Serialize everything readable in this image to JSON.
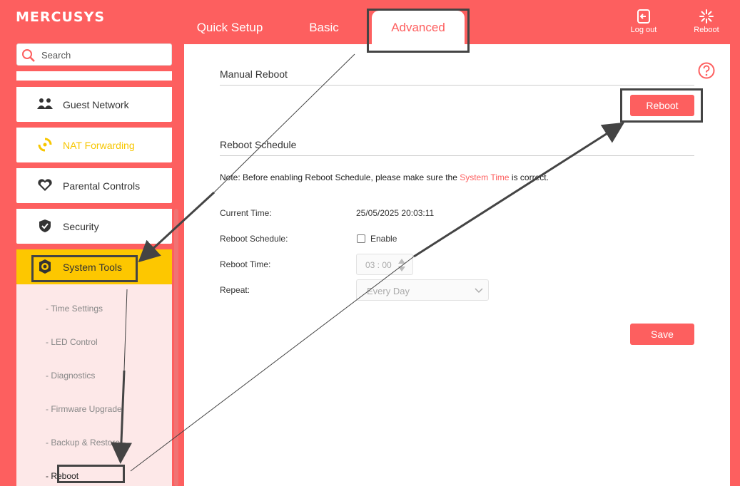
{
  "header": {
    "logo": "MERCUSYS",
    "tabs": [
      {
        "label": "Quick Setup"
      },
      {
        "label": "Basic"
      },
      {
        "label": "Advanced"
      }
    ],
    "logout_label": "Log out",
    "reboot_label": "Reboot"
  },
  "sidebar": {
    "search_placeholder": "Search",
    "items": [
      {
        "label": "Guest Network",
        "icon": "guest-network-icon"
      },
      {
        "label": "NAT Forwarding",
        "icon": "nat-forwarding-icon"
      },
      {
        "label": "Parental Controls",
        "icon": "heart-icon"
      },
      {
        "label": "Security",
        "icon": "shield-icon"
      },
      {
        "label": "System Tools",
        "icon": "gear-icon"
      }
    ],
    "subitems": [
      {
        "label": "- Time Settings"
      },
      {
        "label": "- LED Control"
      },
      {
        "label": "- Diagnostics"
      },
      {
        "label": "- Firmware Upgrade"
      },
      {
        "label": "- Backup & Restore"
      },
      {
        "label": "- Reboot"
      }
    ]
  },
  "main": {
    "manual_reboot_title": "Manual Reboot",
    "reboot_button": "Reboot",
    "schedule_title": "Reboot Schedule",
    "note_prefix": "Note: Before enabling Reboot Schedule, please make sure the ",
    "note_link": "System Time",
    "note_suffix": " is correct.",
    "current_time_label": "Current Time:",
    "current_time_value": "25/05/2025 20:03:11",
    "schedule_label": "Reboot Schedule:",
    "enable_label": "Enable",
    "reboot_time_label": "Reboot Time:",
    "reboot_time_value": "03 : 00",
    "repeat_label": "Repeat:",
    "repeat_value": "Every Day",
    "save_button": "Save"
  },
  "colors": {
    "brand": "#fd5f5f",
    "active_menu": "#fdc700",
    "nat_text": "#f7c600"
  }
}
